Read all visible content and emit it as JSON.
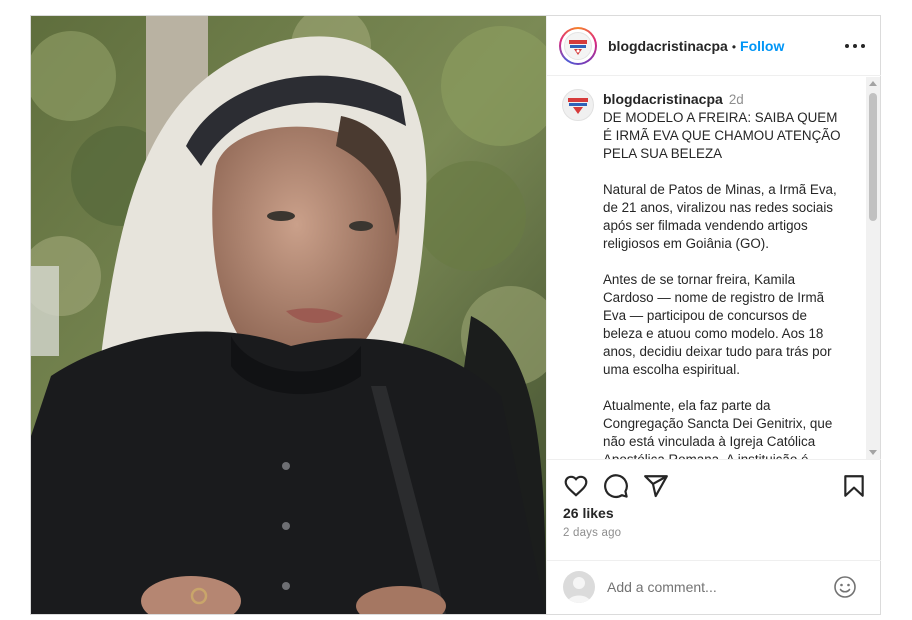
{
  "post": {
    "username": "blogdacristinacpa",
    "follow_label": "Follow",
    "dot": "•",
    "time_short": "2d",
    "caption": [
      "DE MODELO A FREIRA: SAIBA QUEM É IRMÃ EVA QUE CHAMOU ATENÇÃO PELA SUA BELEZA",
      "Natural de Patos de Minas, a Irmã Eva, de 21 anos, viralizou nas redes sociais após ser filmada vendendo artigos religiosos em Goiânia (GO).",
      "Antes de se tornar freira, Kamila Cardoso — nome de registro de Irmã Eva — participou de concursos de beleza e atuou como modelo. Aos 18 anos, decidiu deixar tudo para trás por uma escolha espiritual.",
      "Atualmente, ela faz parte da Congregação Sancta Dei Genitrix, que não está vinculada à Igreja Católica Apostólica Romana. A instituição é"
    ],
    "likes": "26 likes",
    "time_ago": "2 days ago",
    "comment_placeholder": "Add a comment..."
  },
  "icons": {
    "like": "heart-icon",
    "comment": "comment-icon",
    "share": "send-icon",
    "save": "bookmark-icon",
    "more": "more-options-icon",
    "emoji": "emoji-icon"
  },
  "colors": {
    "follow": "#0095f6",
    "text": "#262626",
    "muted": "#8e8e8e"
  }
}
